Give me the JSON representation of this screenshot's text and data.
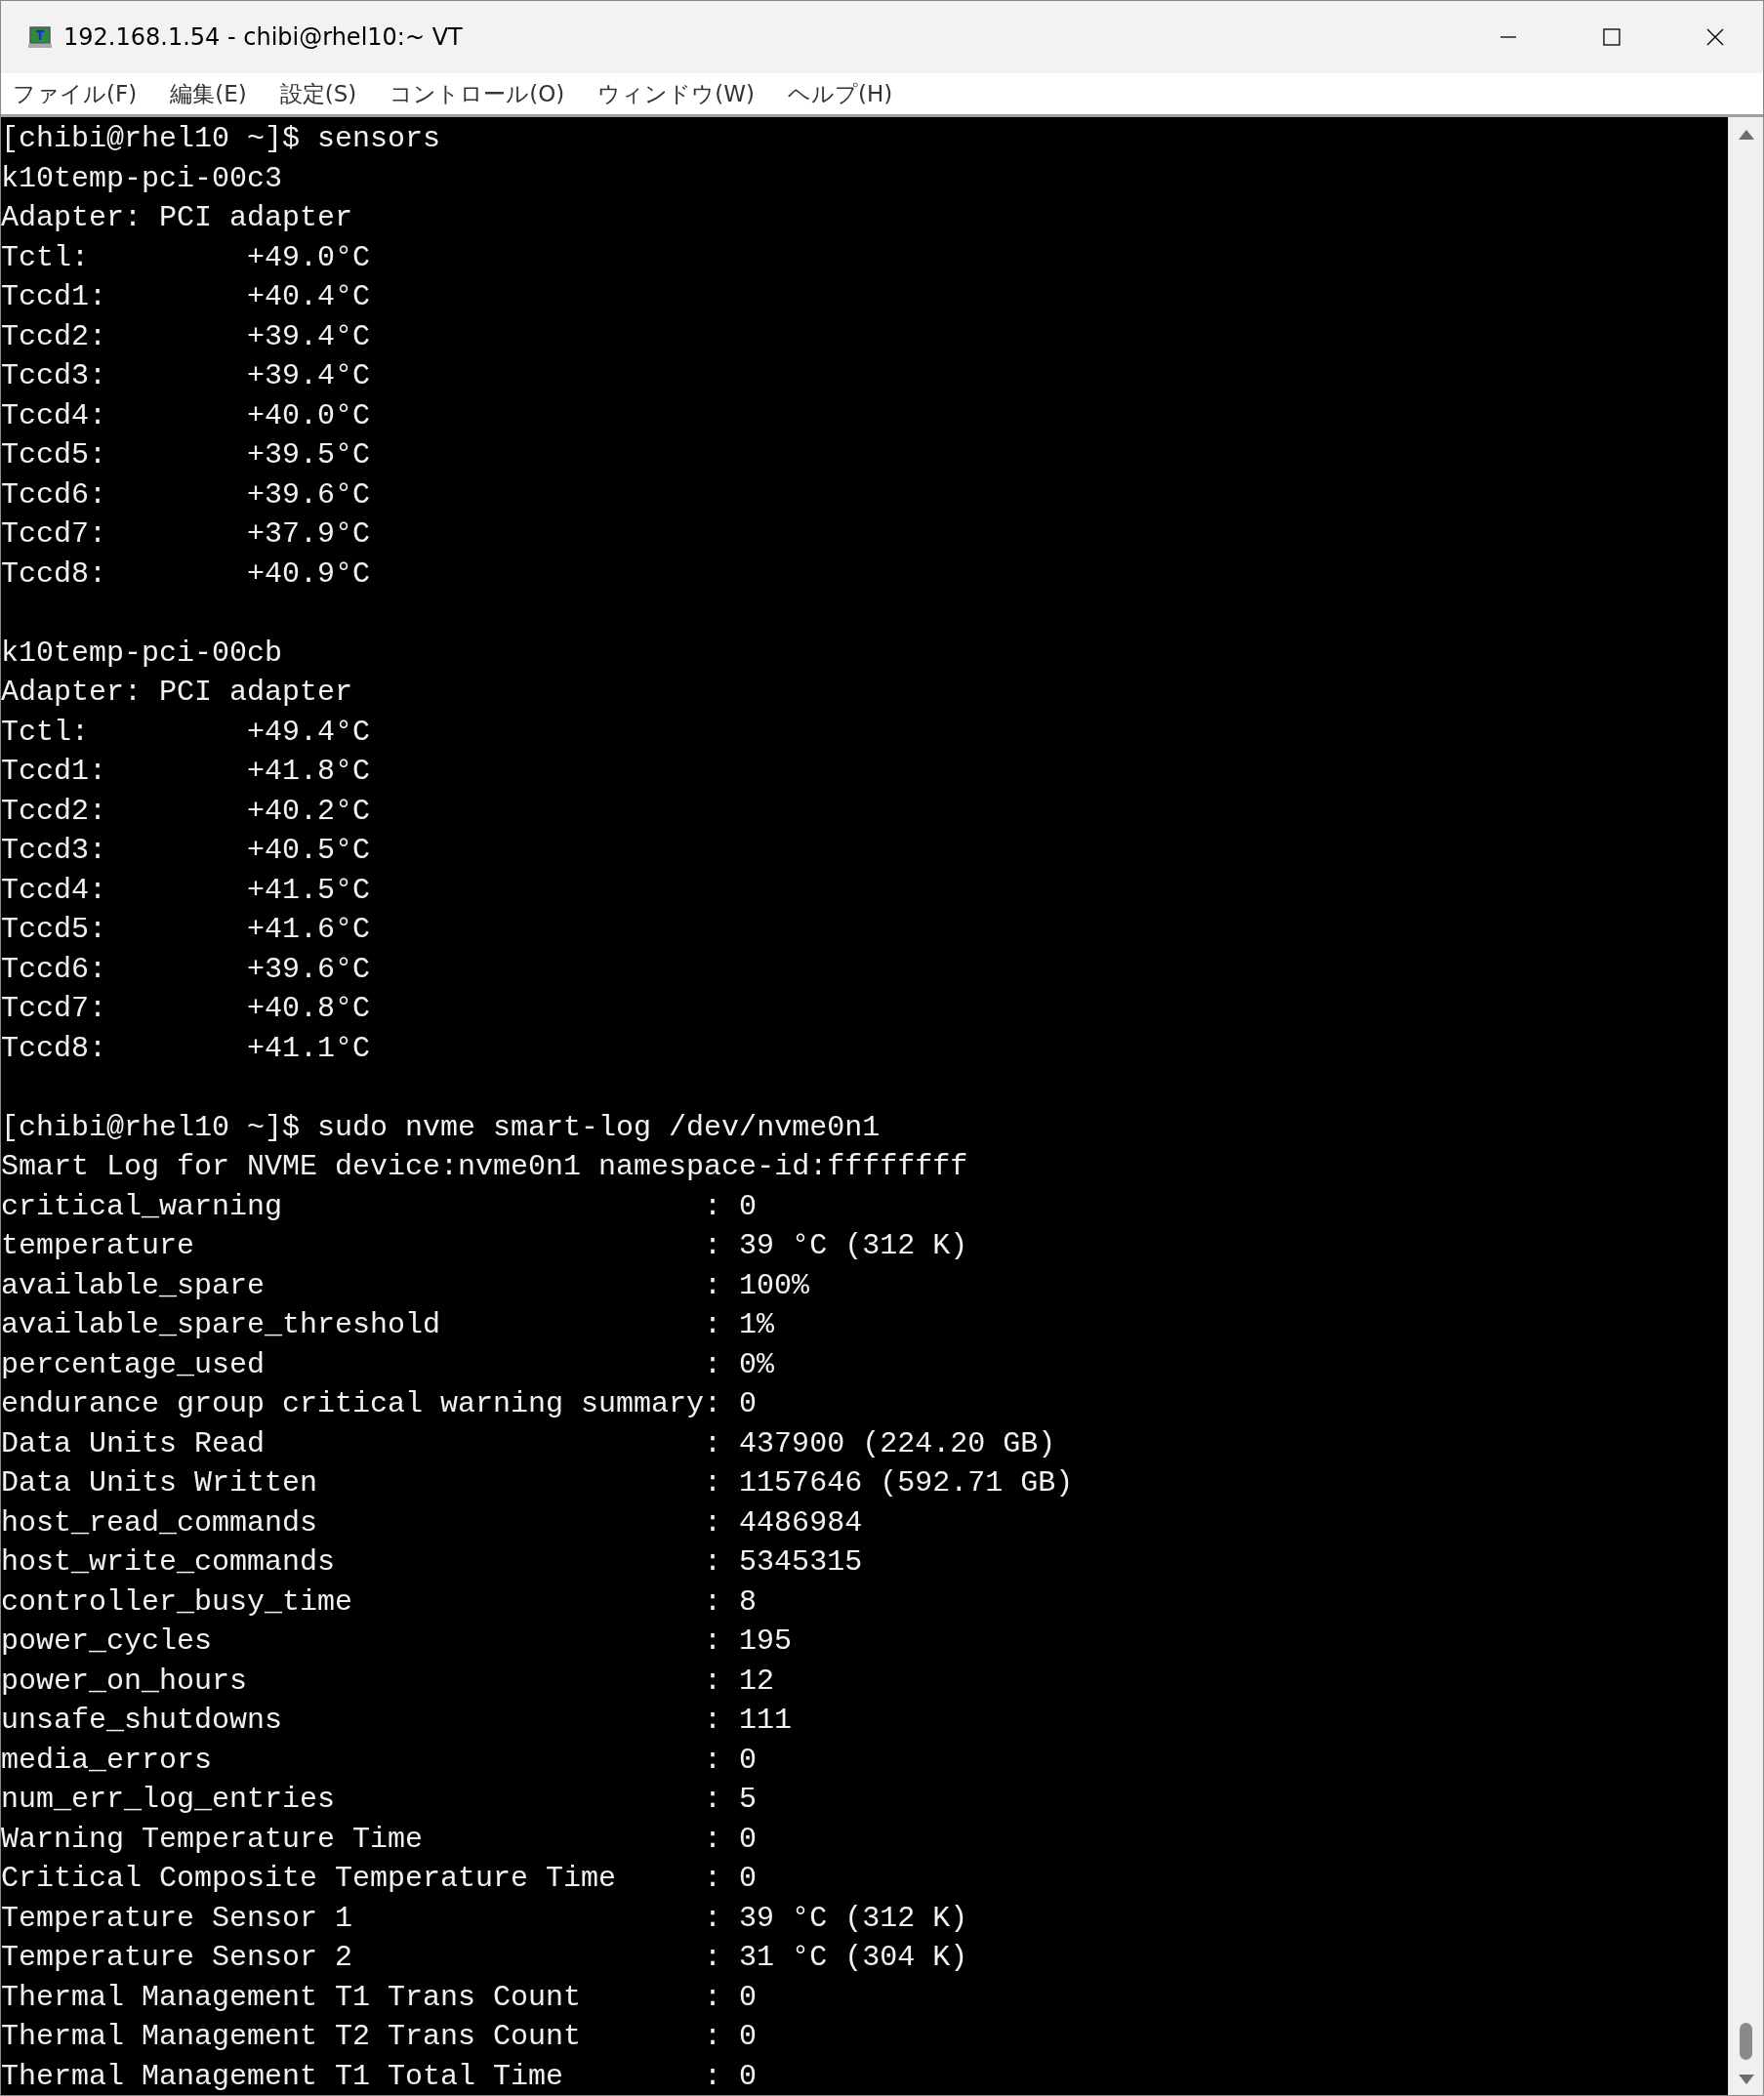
{
  "window": {
    "title": "192.168.1.54 - chibi@rhel10:~ VT"
  },
  "menu": [
    "ファイル(F)",
    "編集(E)",
    "設定(S)",
    "コントロール(O)",
    "ウィンドウ(W)",
    "ヘルプ(H)"
  ],
  "terminal": {
    "lines": [
      {
        "kind": "text",
        "text": "[chibi@rhel10 ~]$ sensors"
      },
      {
        "kind": "text",
        "text": "k10temp-pci-00c3"
      },
      {
        "kind": "text",
        "text": "Adapter: PCI adapter"
      },
      {
        "kind": "reading",
        "label": "Tctl:",
        "value": "+49.0°C"
      },
      {
        "kind": "reading",
        "label": "Tccd1:",
        "value": "+40.4°C"
      },
      {
        "kind": "reading",
        "label": "Tccd2:",
        "value": "+39.4°C"
      },
      {
        "kind": "reading",
        "label": "Tccd3:",
        "value": "+39.4°C"
      },
      {
        "kind": "reading",
        "label": "Tccd4:",
        "value": "+40.0°C"
      },
      {
        "kind": "reading",
        "label": "Tccd5:",
        "value": "+39.5°C"
      },
      {
        "kind": "reading",
        "label": "Tccd6:",
        "value": "+39.6°C"
      },
      {
        "kind": "reading",
        "label": "Tccd7:",
        "value": "+37.9°C"
      },
      {
        "kind": "reading",
        "label": "Tccd8:",
        "value": "+40.9°C"
      },
      {
        "kind": "blank"
      },
      {
        "kind": "text",
        "text": "k10temp-pci-00cb"
      },
      {
        "kind": "text",
        "text": "Adapter: PCI adapter"
      },
      {
        "kind": "reading",
        "label": "Tctl:",
        "value": "+49.4°C"
      },
      {
        "kind": "reading",
        "label": "Tccd1:",
        "value": "+41.8°C"
      },
      {
        "kind": "reading",
        "label": "Tccd2:",
        "value": "+40.2°C"
      },
      {
        "kind": "reading",
        "label": "Tccd3:",
        "value": "+40.5°C"
      },
      {
        "kind": "reading",
        "label": "Tccd4:",
        "value": "+41.5°C"
      },
      {
        "kind": "reading",
        "label": "Tccd5:",
        "value": "+41.6°C"
      },
      {
        "kind": "reading",
        "label": "Tccd6:",
        "value": "+39.6°C"
      },
      {
        "kind": "reading",
        "label": "Tccd7:",
        "value": "+40.8°C"
      },
      {
        "kind": "reading",
        "label": "Tccd8:",
        "value": "+41.1°C"
      },
      {
        "kind": "blank"
      },
      {
        "kind": "text",
        "text": "[chibi@rhel10 ~]$ sudo nvme smart-log /dev/nvme0n1"
      },
      {
        "kind": "text",
        "text": "Smart Log for NVME device:nvme0n1 namespace-id:ffffffff"
      },
      {
        "kind": "field",
        "key": "critical_warning",
        "value": ": 0"
      },
      {
        "kind": "field",
        "key": "temperature",
        "value": ": 39 °C (312 K)"
      },
      {
        "kind": "field",
        "key": "available_spare",
        "value": ": 100%"
      },
      {
        "kind": "field",
        "key": "available_spare_threshold",
        "value": ": 1%"
      },
      {
        "kind": "field",
        "key": "percentage_used",
        "value": ": 0%"
      },
      {
        "kind": "field",
        "key": "endurance group critical warning summary",
        "value": ": 0"
      },
      {
        "kind": "field",
        "key": "Data Units Read",
        "value": ": 437900 (224.20 GB)"
      },
      {
        "kind": "field",
        "key": "Data Units Written",
        "value": ": 1157646 (592.71 GB)"
      },
      {
        "kind": "field",
        "key": "host_read_commands",
        "value": ": 4486984"
      },
      {
        "kind": "field",
        "key": "host_write_commands",
        "value": ": 5345315"
      },
      {
        "kind": "field",
        "key": "controller_busy_time",
        "value": ": 8"
      },
      {
        "kind": "field",
        "key": "power_cycles",
        "value": ": 195"
      },
      {
        "kind": "field",
        "key": "power_on_hours",
        "value": ": 12"
      },
      {
        "kind": "field",
        "key": "unsafe_shutdowns",
        "value": ": 111"
      },
      {
        "kind": "field",
        "key": "media_errors",
        "value": ": 0"
      },
      {
        "kind": "field",
        "key": "num_err_log_entries",
        "value": ": 5"
      },
      {
        "kind": "field",
        "key": "Warning Temperature Time",
        "value": ": 0"
      },
      {
        "kind": "field",
        "key": "Critical Composite Temperature Time",
        "value": ": 0"
      },
      {
        "kind": "field",
        "key": "Temperature Sensor 1",
        "value": ": 39 °C (312 K)"
      },
      {
        "kind": "field",
        "key": "Temperature Sensor 2",
        "value": ": 31 °C (304 K)"
      },
      {
        "kind": "field",
        "key": "Thermal Management T1 Trans Count",
        "value": ": 0"
      },
      {
        "kind": "field",
        "key": "Thermal Management T2 Trans Count",
        "value": ": 0"
      },
      {
        "kind": "field",
        "key": "Thermal Management T1 Total Time",
        "value": ": 0"
      }
    ]
  }
}
